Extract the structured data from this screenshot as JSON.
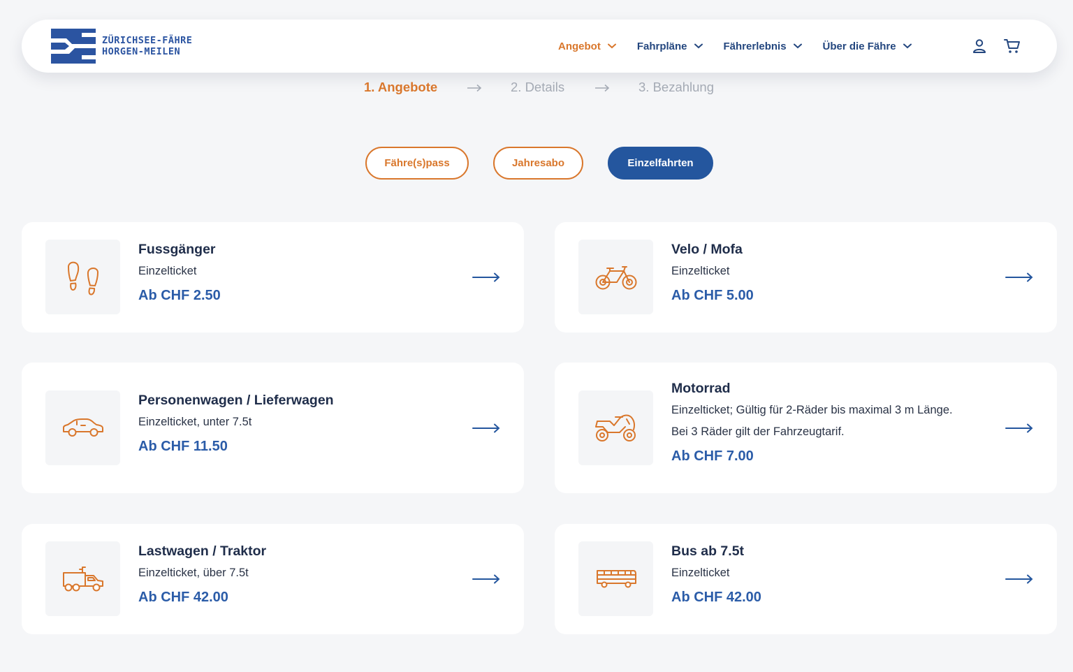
{
  "brand": {
    "line1": "ZÜRICHSEE-FÄHRE",
    "line2": "HORGEN-MEILEN",
    "color": "#2b54a1"
  },
  "nav": [
    {
      "label": "Angebot",
      "active": true
    },
    {
      "label": "Fahrpläne",
      "active": false
    },
    {
      "label": "Fährerlebnis",
      "active": false
    },
    {
      "label": "Über die Fähre",
      "active": false
    }
  ],
  "header_icons": [
    "user-icon",
    "cart-icon"
  ],
  "steps": [
    {
      "label": "1. Angebote",
      "active": true
    },
    {
      "label": "2. Details",
      "active": false
    },
    {
      "label": "3. Bezahlung",
      "active": false
    }
  ],
  "tabs": [
    {
      "label": "Fähre(s)pass",
      "active": false
    },
    {
      "label": "Jahresabo",
      "active": false
    },
    {
      "label": "Einzelfahrten",
      "active": true
    }
  ],
  "offers": [
    {
      "icon": "footprints-icon",
      "title": "Fussgänger",
      "desc": [
        "Einzelticket"
      ],
      "price": "Ab CHF 2.50"
    },
    {
      "icon": "bicycle-icon",
      "title": "Velo / Mofa",
      "desc": [
        "Einzelticket"
      ],
      "price": "Ab CHF 5.00"
    },
    {
      "icon": "car-icon",
      "title": "Personenwagen / Lieferwagen",
      "desc": [
        "Einzelticket, unter 7.5t"
      ],
      "price": "Ab CHF 11.50"
    },
    {
      "icon": "motorcycle-icon",
      "title": "Motorrad",
      "desc": [
        "Einzelticket; Gültig für 2-Räder bis maximal 3 m Länge.",
        "Bei 3 Räder gilt der Fahrzeugtarif."
      ],
      "price": "Ab CHF 7.00"
    },
    {
      "icon": "truck-icon",
      "title": "Lastwagen / Traktor",
      "desc": [
        "Einzelticket, über 7.5t"
      ],
      "price": "Ab CHF 42.00"
    },
    {
      "icon": "bus-icon",
      "title": "Bus ab 7.5t",
      "desc": [
        "Einzelticket"
      ],
      "price": "Ab CHF 42.00"
    }
  ],
  "colors": {
    "accent": "#d9772c",
    "primary": "#24569e",
    "price": "#2b5ca8",
    "background": "#f5f6f8"
  }
}
